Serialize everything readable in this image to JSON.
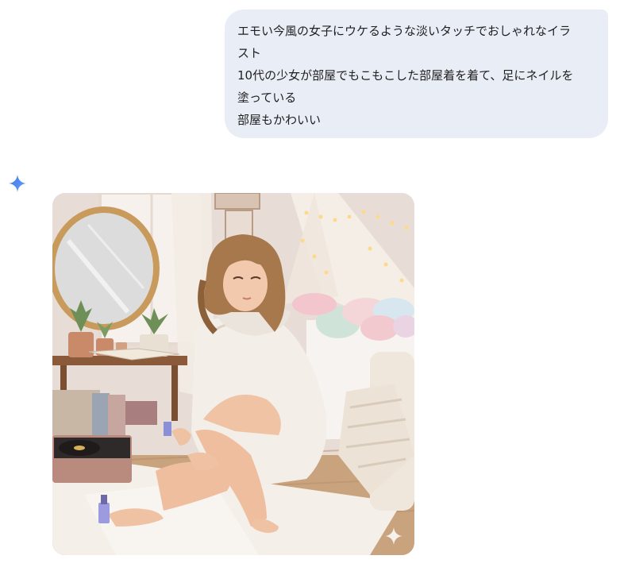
{
  "user_message": {
    "lines": [
      "エモい今風の女子にウケるような淡いタッチでおしゃれなイラ",
      "スト",
      "10代の少女が部屋でもこもこした部屋着を着て、足にネイルを",
      "塗っている",
      "部屋もかわいい"
    ]
  },
  "response": {
    "icon": "gemini-spark-icon",
    "image": {
      "alt": "",
      "watermark_icon": "sparkle-watermark-icon"
    }
  },
  "colors": {
    "user_bubble_bg": "#e9eef6",
    "spark_blue": "#4a86f0",
    "page_bg": "#ffffff"
  }
}
